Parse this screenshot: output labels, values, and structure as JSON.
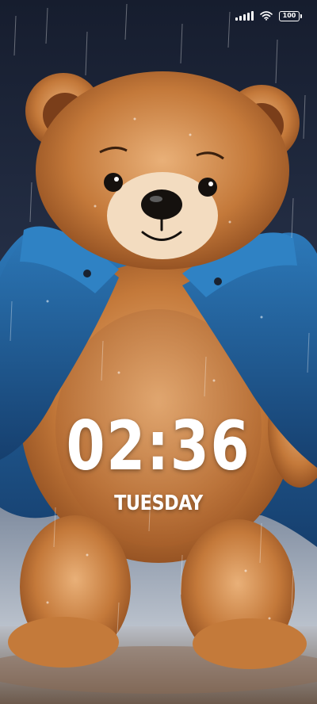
{
  "wallpaper": {
    "subject": "teddy-bear-in-rain",
    "colors": {
      "sky": "#1d2538",
      "fur": "#c47a3a",
      "fur_light": "#e8b27a",
      "jacket": "#1f5f9c",
      "muzzle": "#f3dcc0",
      "ground": "#cfd3d8"
    }
  },
  "status_bar": {
    "icons": [
      "signal-icon",
      "wifi-icon",
      "battery-icon"
    ],
    "battery_level": "100"
  },
  "lock_screen": {
    "time": "02:36",
    "day": "TUESDAY"
  }
}
